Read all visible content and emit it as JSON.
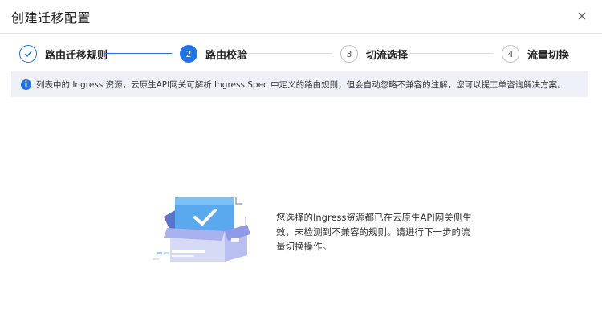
{
  "dialog": {
    "title": "创建迁移配置",
    "close_icon": "close-icon"
  },
  "steps": [
    {
      "label": "路由迁移规则",
      "number": "",
      "status": "done"
    },
    {
      "label": "路由校验",
      "number": "2",
      "status": "active"
    },
    {
      "label": "切流选择",
      "number": "3",
      "status": "wait"
    },
    {
      "label": "流量切换",
      "number": "4",
      "status": "wait"
    }
  ],
  "info": {
    "icon": "info-icon",
    "text": "列表中的 Ingress 资源，云原生API网关可解析 Ingress Spec 中定义的路由规则，但会自动忽略不兼容的注解，您可以提工单咨询解决方案。"
  },
  "result": {
    "illustration": "box-checkmark-illustration",
    "message": "您选择的Ingress资源都已在云原生API网关侧生效，未检测到不兼容的规则。请进行下一步的流量切换操作。"
  },
  "colors": {
    "accent": "#1e73e8",
    "info_bg": "#eef2f8"
  }
}
